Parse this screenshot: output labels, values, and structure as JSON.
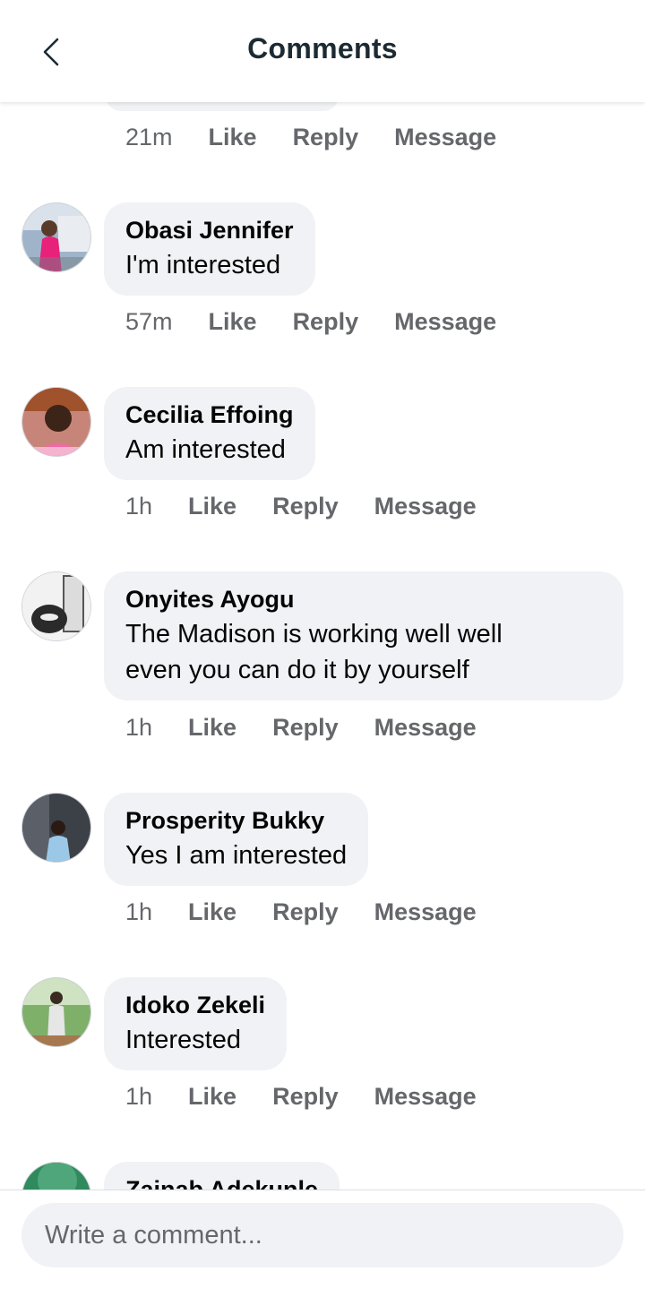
{
  "header": {
    "title": "Comments",
    "back_icon": "chevron-left-icon"
  },
  "top_partial": {
    "time": "21m",
    "like": "Like",
    "reply": "Reply",
    "message": "Message"
  },
  "comments": [
    {
      "name": "Obasi Jennifer",
      "text": "I'm interested",
      "time": "57m",
      "like": "Like",
      "reply": "Reply",
      "message": "Message"
    },
    {
      "name": "Cecilia Effoing",
      "text": "Am interested",
      "time": "1h",
      "like": "Like",
      "reply": "Reply",
      "message": "Message"
    },
    {
      "name": "Onyites Ayogu",
      "text_lines": [
        "The Madison is working well well",
        "even you can do it by yourself"
      ],
      "time": "1h",
      "like": "Like",
      "reply": "Reply",
      "message": "Message"
    },
    {
      "name": "Prosperity Bukky",
      "text": "Yes I am interested",
      "time": "1h",
      "like": "Like",
      "reply": "Reply",
      "message": "Message"
    },
    {
      "name": "Idoko Zekeli",
      "text": "Interested",
      "time": "1h",
      "like": "Like",
      "reply": "Reply",
      "message": "Message"
    },
    {
      "name": "Zainab Adekunle"
    }
  ],
  "composer": {
    "placeholder": "Write a comment..."
  },
  "colors": {
    "bubble": "#f0f2f5",
    "meta_text": "#65676b",
    "title": "#1c2b33"
  }
}
